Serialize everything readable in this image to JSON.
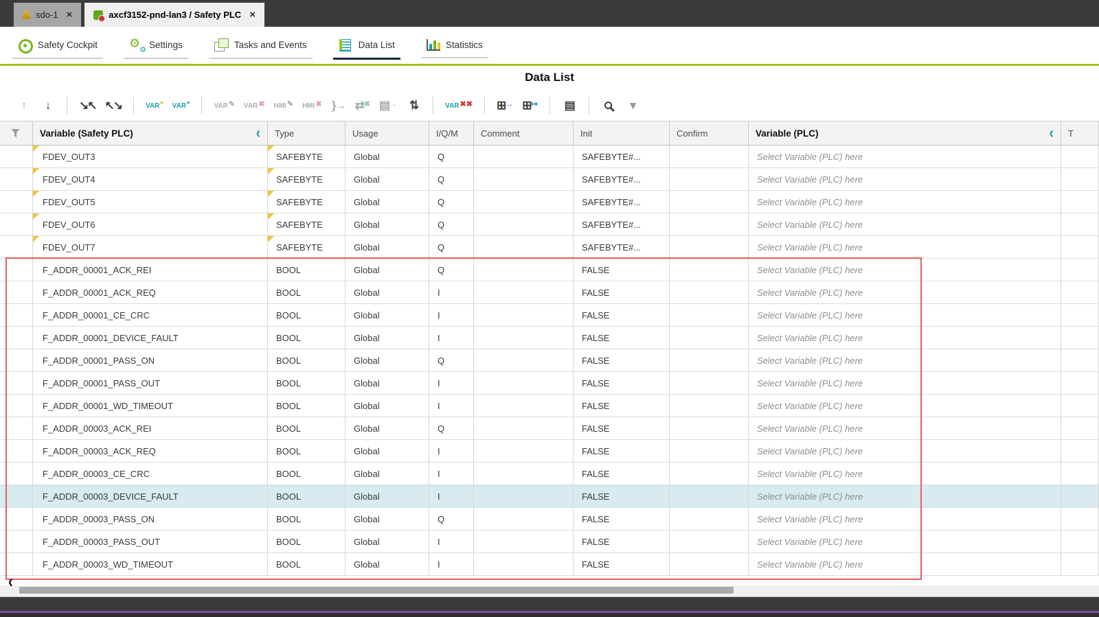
{
  "window": {
    "tabs": [
      {
        "label": "sdo-1",
        "close_label": "×"
      },
      {
        "label": "axcf3152-pnd-lan3 / Safety PLC",
        "close_label": "×"
      }
    ]
  },
  "nav": {
    "active_index": 3,
    "items": [
      {
        "label": "Safety Cockpit"
      },
      {
        "label": "Settings"
      },
      {
        "label": "Tasks and Events"
      },
      {
        "label": "Data List"
      },
      {
        "label": "Statistics"
      }
    ]
  },
  "page": {
    "title": "Data List"
  },
  "toolbar": {
    "items": [
      {
        "name": "move-up-icon",
        "glyph": "↑",
        "color": "#b3a79b",
        "enabled": false
      },
      {
        "name": "move-down-icon",
        "glyph": "↓",
        "color": "#3d3d3d",
        "enabled": true
      },
      {
        "name": "separator"
      },
      {
        "name": "collapse-rows-icon",
        "glyph": "↘↖",
        "color": "#3d3d3d",
        "enabled": true
      },
      {
        "name": "expand-rows-icon",
        "glyph": "↖↘",
        "color": "#3d3d3d",
        "enabled": true
      },
      {
        "name": "separator"
      },
      {
        "name": "add-safety-variable-icon",
        "label": "VAR",
        "label_color": "#1aa0ac",
        "mark": "*",
        "mark_color": "#e8b400",
        "enabled": true
      },
      {
        "name": "add-standard-variable-icon",
        "label": "VAR",
        "label_color": "#1aa0ac",
        "mark": "*",
        "mark_color": "#1aa0ac",
        "enabled": true
      },
      {
        "name": "separator"
      },
      {
        "name": "edit-variable-icon",
        "label": "VAR",
        "label_color": "#a7b0b4",
        "mark": "✎",
        "mark_color": "#a7b0b4",
        "enabled": false
      },
      {
        "name": "remove-variable-icon",
        "label": "VAR",
        "label_color": "#a7b0b4",
        "mark": "✖",
        "mark_color": "#e0a8a8",
        "enabled": false
      },
      {
        "name": "edit-hmi-icon",
        "label": "HMI",
        "label_color": "#a7b0b4",
        "mark": "✎",
        "mark_color": "#a7b0b4",
        "enabled": false
      },
      {
        "name": "remove-hmi-icon",
        "label": "HMI",
        "label_color": "#a7b0b4",
        "mark": "✖",
        "mark_color": "#e0a8a8",
        "enabled": false
      },
      {
        "name": "assign-process-data-icon",
        "glyph": "}→",
        "color": "#a8a8a8",
        "enabled": false
      },
      {
        "name": "refresh-assignment-icon",
        "glyph": "⇄",
        "color": "#a8a8a8",
        "mark": "✖",
        "mark_color": "#8fc7cc",
        "enabled": false
      },
      {
        "name": "copy-assignment-icon",
        "glyph": "▤",
        "color": "#a8a8a8",
        "mark": "→",
        "mark_color": "#8fc7cc",
        "enabled": false
      },
      {
        "name": "swap-direction-icon",
        "glyph": "⇅",
        "color": "#3d3d3d",
        "enabled": true
      },
      {
        "name": "separator"
      },
      {
        "name": "delete-variables-icon",
        "label": "VAR",
        "label_color": "#1aa0ac",
        "mark": "✖✖",
        "mark_color": "#d63a2f",
        "enabled": true
      },
      {
        "name": "separator"
      },
      {
        "name": "import-variables-icon",
        "glyph": "⊞",
        "color": "#3d3d3d",
        "mark": "→",
        "mark_color": "#1f7fd0",
        "enabled": true
      },
      {
        "name": "export-variables-icon",
        "glyph": "⊞",
        "color": "#3d3d3d",
        "mark": "↦",
        "mark_color": "#1f7fd0",
        "enabled": true
      },
      {
        "name": "separator"
      },
      {
        "name": "column-properties-icon",
        "glyph": "▤",
        "color": "#3d3d3d",
        "enabled": true
      },
      {
        "name": "separator"
      },
      {
        "name": "search-icon",
        "magnifier": true,
        "enabled": true
      },
      {
        "name": "search-options-icon",
        "glyph": "▾",
        "color": "#9a9a9a",
        "enabled": true
      }
    ]
  },
  "table": {
    "header": {
      "variable_safety": "Variable (Safety PLC)",
      "type": "Type",
      "usage": "Usage",
      "iqm": "I/Q/M",
      "comment": "Comment",
      "init": "Init",
      "confirm": "Confirm",
      "variable_plc": "Variable (PLC)",
      "type_plc_truncated": "T",
      "collapse_glyph": "‹"
    },
    "plc_placeholder": "Select Variable (PLC) here",
    "rows": [
      {
        "name": "FDEV_OUT3",
        "type": "SAFEBYTE",
        "usage": "Global",
        "iqm": "Q",
        "comment": "",
        "init": "SAFEBYTE#...",
        "confirm": "",
        "modified": true
      },
      {
        "name": "FDEV_OUT4",
        "type": "SAFEBYTE",
        "usage": "Global",
        "iqm": "Q",
        "comment": "",
        "init": "SAFEBYTE#...",
        "confirm": "",
        "modified": true
      },
      {
        "name": "FDEV_OUT5",
        "type": "SAFEBYTE",
        "usage": "Global",
        "iqm": "Q",
        "comment": "",
        "init": "SAFEBYTE#...",
        "confirm": "",
        "modified": true
      },
      {
        "name": "FDEV_OUT6",
        "type": "SAFEBYTE",
        "usage": "Global",
        "iqm": "Q",
        "comment": "",
        "init": "SAFEBYTE#...",
        "confirm": "",
        "modified": true
      },
      {
        "name": "FDEV_OUT7",
        "type": "SAFEBYTE",
        "usage": "Global",
        "iqm": "Q",
        "comment": "",
        "init": "SAFEBYTE#...",
        "confirm": "",
        "modified": true
      },
      {
        "name": "F_ADDR_00001_ACK_REI",
        "type": "BOOL",
        "usage": "Global",
        "iqm": "Q",
        "comment": "",
        "init": "FALSE",
        "confirm": ""
      },
      {
        "name": "F_ADDR_00001_ACK_REQ",
        "type": "BOOL",
        "usage": "Global",
        "iqm": "I",
        "comment": "",
        "init": "FALSE",
        "confirm": ""
      },
      {
        "name": "F_ADDR_00001_CE_CRC",
        "type": "BOOL",
        "usage": "Global",
        "iqm": "I",
        "comment": "",
        "init": "FALSE",
        "confirm": ""
      },
      {
        "name": "F_ADDR_00001_DEVICE_FAULT",
        "type": "BOOL",
        "usage": "Global",
        "iqm": "I",
        "comment": "",
        "init": "FALSE",
        "confirm": ""
      },
      {
        "name": "F_ADDR_00001_PASS_ON",
        "type": "BOOL",
        "usage": "Global",
        "iqm": "Q",
        "comment": "",
        "init": "FALSE",
        "confirm": ""
      },
      {
        "name": "F_ADDR_00001_PASS_OUT",
        "type": "BOOL",
        "usage": "Global",
        "iqm": "I",
        "comment": "",
        "init": "FALSE",
        "confirm": ""
      },
      {
        "name": "F_ADDR_00001_WD_TIMEOUT",
        "type": "BOOL",
        "usage": "Global",
        "iqm": "I",
        "comment": "",
        "init": "FALSE",
        "confirm": ""
      },
      {
        "name": "F_ADDR_00003_ACK_REI",
        "type": "BOOL",
        "usage": "Global",
        "iqm": "Q",
        "comment": "",
        "init": "FALSE",
        "confirm": ""
      },
      {
        "name": "F_ADDR_00003_ACK_REQ",
        "type": "BOOL",
        "usage": "Global",
        "iqm": "I",
        "comment": "",
        "init": "FALSE",
        "confirm": ""
      },
      {
        "name": "F_ADDR_00003_CE_CRC",
        "type": "BOOL",
        "usage": "Global",
        "iqm": "I",
        "comment": "",
        "init": "FALSE",
        "confirm": ""
      },
      {
        "name": "F_ADDR_00003_DEVICE_FAULT",
        "type": "BOOL",
        "usage": "Global",
        "iqm": "I",
        "comment": "",
        "init": "FALSE",
        "confirm": "",
        "selected": true
      },
      {
        "name": "F_ADDR_00003_PASS_ON",
        "type": "BOOL",
        "usage": "Global",
        "iqm": "Q",
        "comment": "",
        "init": "FALSE",
        "confirm": ""
      },
      {
        "name": "F_ADDR_00003_PASS_OUT",
        "type": "BOOL",
        "usage": "Global",
        "iqm": "I",
        "comment": "",
        "init": "FALSE",
        "confirm": ""
      },
      {
        "name": "F_ADDR_00003_WD_TIMEOUT",
        "type": "BOOL",
        "usage": "Global",
        "iqm": "I",
        "comment": "",
        "init": "FALSE",
        "confirm": ""
      }
    ]
  },
  "footer": {
    "scroll_left_glyph": "‹"
  },
  "colors": {
    "accent_lime": "#a3c41d",
    "teal": "#1aa0ac",
    "selected_row": "#d7ebf1",
    "annotation_red": "#e3605a",
    "modified_marker": "#f3c33c",
    "bottom_purple": "#7a50a5"
  }
}
